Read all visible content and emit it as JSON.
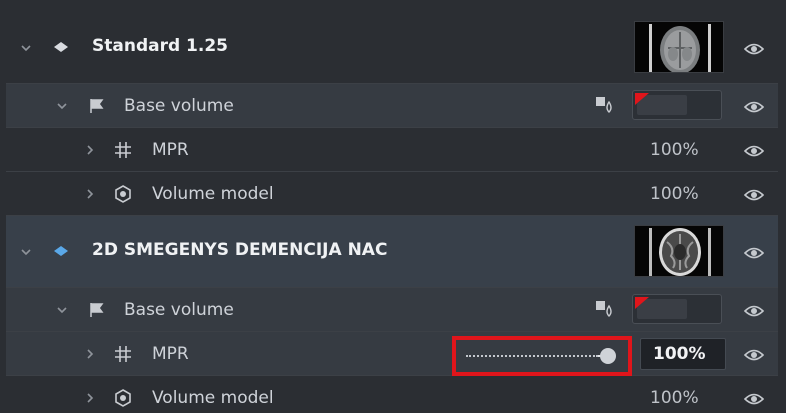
{
  "series": [
    {
      "name": "Standard 1.25",
      "base": {
        "label": "Base volume",
        "children": [
          {
            "label": "MPR",
            "opacity": "100%"
          },
          {
            "label": "Volume model",
            "opacity": "100%"
          }
        ]
      }
    },
    {
      "name": "2D SMEGENYS DEMENCIJA NAC",
      "base": {
        "label": "Base volume",
        "children": [
          {
            "label": "MPR",
            "opacity": "100%",
            "slider_value": 1.0
          },
          {
            "label": "Volume model",
            "opacity": "100%"
          }
        ]
      }
    }
  ],
  "icons": {
    "series": "diamond-icon",
    "volume": "volume-icon",
    "mpr": "mpr-icon",
    "model": "volume-model-icon",
    "visibility": "eye-icon",
    "colormap": "color-drop-icon"
  },
  "colors": {
    "panel": "#2b2e33",
    "active_row": "#38404a",
    "highlight": "#e0151b",
    "selected_diamond": "#5aa8e8"
  }
}
